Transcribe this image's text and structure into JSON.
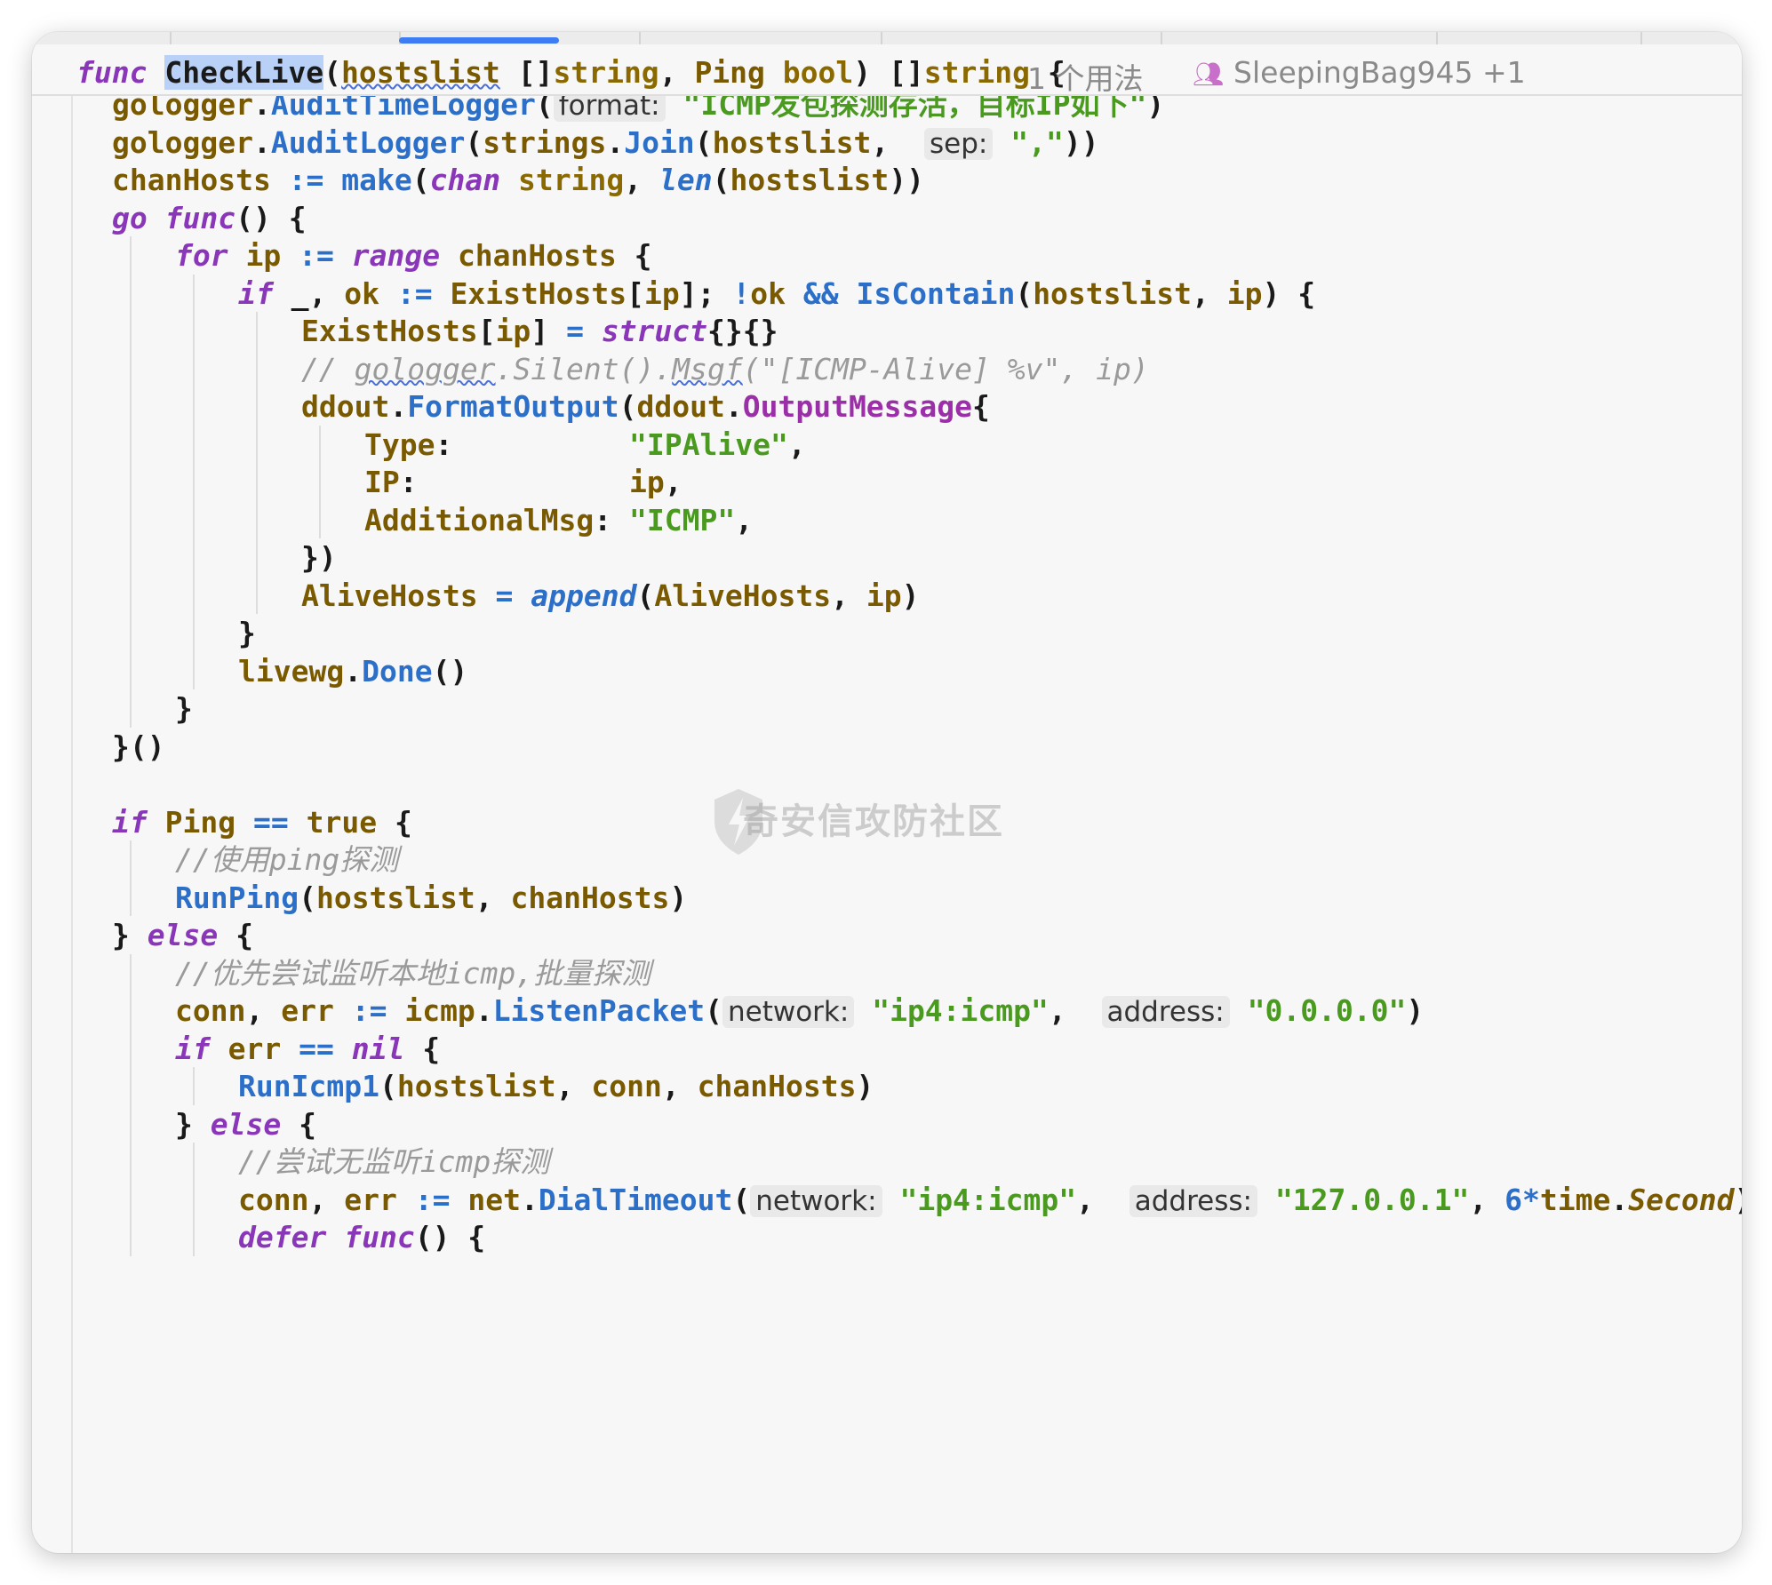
{
  "sticky": {
    "signature": [
      {
        "t": "func",
        "c": "kw"
      },
      {
        "t": " ",
        "c": "pl"
      },
      {
        "t": "CheckLive",
        "c": "sel"
      },
      {
        "t": "(",
        "c": "pl"
      },
      {
        "t": "hostslist",
        "c": "id squig"
      },
      {
        "t": " []",
        "c": "pl"
      },
      {
        "t": "string",
        "c": "ty"
      },
      {
        "t": ", ",
        "c": "pl"
      },
      {
        "t": "Ping",
        "c": "id"
      },
      {
        "t": " ",
        "c": "pl"
      },
      {
        "t": "bool",
        "c": "ty"
      },
      {
        "t": ") []",
        "c": "pl"
      },
      {
        "t": "string",
        "c": "ty"
      },
      {
        "t": " {",
        "c": "pl"
      }
    ],
    "usages": "1 个用法",
    "authors": "SleepingBag945 +1"
  },
  "watermark": "奇安信攻防社区",
  "lines": [
    {
      "indent": 1,
      "tokens": [
        {
          "t": "gologger",
          "c": "id"
        },
        {
          "t": ".",
          "c": "pl"
        },
        {
          "t": "AuditTimeLogger",
          "c": "fn"
        },
        {
          "t": "(",
          "c": "pl"
        },
        {
          "t": "format:",
          "c": "hintbox"
        },
        {
          "t": " ",
          "c": "pl"
        },
        {
          "t": "\"ICMP发包探测存活，目标IP如下\"",
          "c": "st"
        },
        {
          "t": ")",
          "c": "pl"
        }
      ]
    },
    {
      "indent": 1,
      "tokens": [
        {
          "t": "gologger",
          "c": "id"
        },
        {
          "t": ".",
          "c": "pl"
        },
        {
          "t": "AuditLogger",
          "c": "fn"
        },
        {
          "t": "(",
          "c": "pl"
        },
        {
          "t": "strings",
          "c": "id"
        },
        {
          "t": ".",
          "c": "pl"
        },
        {
          "t": "Join",
          "c": "fn"
        },
        {
          "t": "(",
          "c": "pl"
        },
        {
          "t": "hostslist",
          "c": "id"
        },
        {
          "t": ",  ",
          "c": "pl"
        },
        {
          "t": "sep:",
          "c": "hintbox"
        },
        {
          "t": " ",
          "c": "pl"
        },
        {
          "t": "\",\"",
          "c": "st"
        },
        {
          "t": "))",
          "c": "pl"
        }
      ]
    },
    {
      "indent": 1,
      "tokens": [
        {
          "t": "chanHosts",
          "c": "id"
        },
        {
          "t": " := ",
          "c": "op"
        },
        {
          "t": "make",
          "c": "fn"
        },
        {
          "t": "(",
          "c": "pl"
        },
        {
          "t": "chan",
          "c": "kw"
        },
        {
          "t": " ",
          "c": "pl"
        },
        {
          "t": "string",
          "c": "ty"
        },
        {
          "t": ", ",
          "c": "pl"
        },
        {
          "t": "len",
          "c": "fn kw"
        },
        {
          "t": "(",
          "c": "pl"
        },
        {
          "t": "hostslist",
          "c": "id"
        },
        {
          "t": "))",
          "c": "pl"
        }
      ]
    },
    {
      "indent": 1,
      "tokens": [
        {
          "t": "go",
          "c": "kw"
        },
        {
          "t": " ",
          "c": "pl"
        },
        {
          "t": "func",
          "c": "kw"
        },
        {
          "t": "() {",
          "c": "pl"
        }
      ]
    },
    {
      "indent": 2,
      "tokens": [
        {
          "t": "for",
          "c": "kw"
        },
        {
          "t": " ",
          "c": "pl"
        },
        {
          "t": "ip",
          "c": "id"
        },
        {
          "t": " := ",
          "c": "op"
        },
        {
          "t": "range",
          "c": "kw"
        },
        {
          "t": " ",
          "c": "pl"
        },
        {
          "t": "chanHosts",
          "c": "id"
        },
        {
          "t": " {",
          "c": "pl"
        }
      ]
    },
    {
      "indent": 3,
      "tokens": [
        {
          "t": "if",
          "c": "kw"
        },
        {
          "t": " _, ",
          "c": "pl"
        },
        {
          "t": "ok",
          "c": "id"
        },
        {
          "t": " := ",
          "c": "op"
        },
        {
          "t": "ExistHosts",
          "c": "id"
        },
        {
          "t": "[",
          "c": "pl"
        },
        {
          "t": "ip",
          "c": "id"
        },
        {
          "t": "]; ",
          "c": "pl"
        },
        {
          "t": "!",
          "c": "op"
        },
        {
          "t": "ok",
          "c": "id"
        },
        {
          "t": " && ",
          "c": "op"
        },
        {
          "t": "IsContain",
          "c": "fn"
        },
        {
          "t": "(",
          "c": "pl"
        },
        {
          "t": "hostslist",
          "c": "id"
        },
        {
          "t": ", ",
          "c": "pl"
        },
        {
          "t": "ip",
          "c": "id"
        },
        {
          "t": ") {",
          "c": "pl"
        }
      ]
    },
    {
      "indent": 4,
      "tokens": [
        {
          "t": "ExistHosts",
          "c": "id"
        },
        {
          "t": "[",
          "c": "pl"
        },
        {
          "t": "ip",
          "c": "id"
        },
        {
          "t": "] ",
          "c": "pl"
        },
        {
          "t": "=",
          "c": "op"
        },
        {
          "t": " ",
          "c": "pl"
        },
        {
          "t": "struct",
          "c": "kw"
        },
        {
          "t": "{}{}",
          "c": "pl"
        }
      ]
    },
    {
      "indent": 4,
      "tokens": [
        {
          "t": "// ",
          "c": "cm"
        },
        {
          "t": "gologger",
          "c": "cm squig"
        },
        {
          "t": ".Silent().",
          "c": "cm"
        },
        {
          "t": "Msgf",
          "c": "cm squig"
        },
        {
          "t": "(\"[ICMP-Alive] %v\", ip)",
          "c": "cm"
        }
      ]
    },
    {
      "indent": 4,
      "tokens": [
        {
          "t": "ddout",
          "c": "id"
        },
        {
          "t": ".",
          "c": "pl"
        },
        {
          "t": "FormatOutput",
          "c": "fn"
        },
        {
          "t": "(",
          "c": "pl"
        },
        {
          "t": "ddout",
          "c": "id"
        },
        {
          "t": ".",
          "c": "pl"
        },
        {
          "t": "OutputMessage",
          "c": "kw2"
        },
        {
          "t": "{",
          "c": "pl"
        }
      ]
    },
    {
      "indent": 5,
      "tokens": [
        {
          "t": "Type",
          "c": "id"
        },
        {
          "t": ":          ",
          "c": "pl"
        },
        {
          "t": "\"IPAlive\"",
          "c": "st"
        },
        {
          "t": ",",
          "c": "pl"
        }
      ]
    },
    {
      "indent": 5,
      "tokens": [
        {
          "t": "IP",
          "c": "id"
        },
        {
          "t": ":            ",
          "c": "pl"
        },
        {
          "t": "ip",
          "c": "id"
        },
        {
          "t": ",",
          "c": "pl"
        }
      ]
    },
    {
      "indent": 5,
      "tokens": [
        {
          "t": "AdditionalMsg",
          "c": "id"
        },
        {
          "t": ": ",
          "c": "pl"
        },
        {
          "t": "\"ICMP\"",
          "c": "st"
        },
        {
          "t": ",",
          "c": "pl"
        }
      ]
    },
    {
      "indent": 4,
      "tokens": [
        {
          "t": "})",
          "c": "pl"
        }
      ]
    },
    {
      "indent": 4,
      "tokens": [
        {
          "t": "AliveHosts",
          "c": "id"
        },
        {
          "t": " = ",
          "c": "op"
        },
        {
          "t": "append",
          "c": "fn kw"
        },
        {
          "t": "(",
          "c": "pl"
        },
        {
          "t": "AliveHosts",
          "c": "id"
        },
        {
          "t": ", ",
          "c": "pl"
        },
        {
          "t": "ip",
          "c": "id"
        },
        {
          "t": ")",
          "c": "pl"
        }
      ]
    },
    {
      "indent": 3,
      "tokens": [
        {
          "t": "}",
          "c": "pl"
        }
      ]
    },
    {
      "indent": 3,
      "tokens": [
        {
          "t": "livewg",
          "c": "id"
        },
        {
          "t": ".",
          "c": "pl"
        },
        {
          "t": "Done",
          "c": "fn"
        },
        {
          "t": "()",
          "c": "pl"
        }
      ]
    },
    {
      "indent": 2,
      "tokens": [
        {
          "t": "}",
          "c": "pl"
        }
      ]
    },
    {
      "indent": 1,
      "tokens": [
        {
          "t": "}()",
          "c": "pl"
        }
      ]
    },
    {
      "indent": 1,
      "tokens": []
    },
    {
      "indent": 1,
      "tokens": [
        {
          "t": "if",
          "c": "kw"
        },
        {
          "t": " ",
          "c": "pl"
        },
        {
          "t": "Ping",
          "c": "id"
        },
        {
          "t": " == ",
          "c": "op"
        },
        {
          "t": "true",
          "c": "id"
        },
        {
          "t": " {",
          "c": "pl"
        }
      ]
    },
    {
      "indent": 2,
      "tokens": [
        {
          "t": "//使用ping探测",
          "c": "cm"
        }
      ]
    },
    {
      "indent": 2,
      "tokens": [
        {
          "t": "RunPing",
          "c": "fn"
        },
        {
          "t": "(",
          "c": "pl"
        },
        {
          "t": "hostslist",
          "c": "id"
        },
        {
          "t": ", ",
          "c": "pl"
        },
        {
          "t": "chanHosts",
          "c": "id"
        },
        {
          "t": ")",
          "c": "pl"
        }
      ]
    },
    {
      "indent": 1,
      "tokens": [
        {
          "t": "} ",
          "c": "pl"
        },
        {
          "t": "else",
          "c": "kw"
        },
        {
          "t": " {",
          "c": "pl"
        }
      ]
    },
    {
      "indent": 2,
      "tokens": [
        {
          "t": "//优先尝试监听本地icmp,批量探测",
          "c": "cm"
        }
      ]
    },
    {
      "indent": 2,
      "tokens": [
        {
          "t": "conn",
          "c": "id"
        },
        {
          "t": ", ",
          "c": "pl"
        },
        {
          "t": "err",
          "c": "id"
        },
        {
          "t": " := ",
          "c": "op"
        },
        {
          "t": "icmp",
          "c": "id"
        },
        {
          "t": ".",
          "c": "pl"
        },
        {
          "t": "ListenPacket",
          "c": "fn"
        },
        {
          "t": "(",
          "c": "pl"
        },
        {
          "t": "network:",
          "c": "hintbox"
        },
        {
          "t": " ",
          "c": "pl"
        },
        {
          "t": "\"ip4:icmp\"",
          "c": "st"
        },
        {
          "t": ",  ",
          "c": "pl"
        },
        {
          "t": "address:",
          "c": "hintbox"
        },
        {
          "t": " ",
          "c": "pl"
        },
        {
          "t": "\"0.0.0.0\"",
          "c": "st"
        },
        {
          "t": ")",
          "c": "pl"
        }
      ]
    },
    {
      "indent": 2,
      "tokens": [
        {
          "t": "if",
          "c": "kw"
        },
        {
          "t": " ",
          "c": "pl"
        },
        {
          "t": "err",
          "c": "id"
        },
        {
          "t": " == ",
          "c": "op"
        },
        {
          "t": "nil",
          "c": "kw"
        },
        {
          "t": " {",
          "c": "pl"
        }
      ]
    },
    {
      "indent": 3,
      "tokens": [
        {
          "t": "RunIcmp1",
          "c": "fn"
        },
        {
          "t": "(",
          "c": "pl"
        },
        {
          "t": "hostslist",
          "c": "id"
        },
        {
          "t": ", ",
          "c": "pl"
        },
        {
          "t": "conn",
          "c": "id"
        },
        {
          "t": ", ",
          "c": "pl"
        },
        {
          "t": "chanHosts",
          "c": "id"
        },
        {
          "t": ")",
          "c": "pl"
        }
      ]
    },
    {
      "indent": 2,
      "tokens": [
        {
          "t": "} ",
          "c": "pl"
        },
        {
          "t": "else",
          "c": "kw"
        },
        {
          "t": " {",
          "c": "pl"
        }
      ]
    },
    {
      "indent": 3,
      "tokens": [
        {
          "t": "//尝试无监听icmp探测",
          "c": "cm"
        }
      ]
    },
    {
      "indent": 3,
      "tokens": [
        {
          "t": "conn",
          "c": "id"
        },
        {
          "t": ", ",
          "c": "pl"
        },
        {
          "t": "err",
          "c": "id"
        },
        {
          "t": " := ",
          "c": "op"
        },
        {
          "t": "net",
          "c": "id"
        },
        {
          "t": ".",
          "c": "pl"
        },
        {
          "t": "DialTimeout",
          "c": "fn"
        },
        {
          "t": "(",
          "c": "pl"
        },
        {
          "t": "network:",
          "c": "hintbox"
        },
        {
          "t": " ",
          "c": "pl"
        },
        {
          "t": "\"ip4:icmp\"",
          "c": "st"
        },
        {
          "t": ",  ",
          "c": "pl"
        },
        {
          "t": "address:",
          "c": "hintbox"
        },
        {
          "t": " ",
          "c": "pl"
        },
        {
          "t": "\"127.0.0.1\"",
          "c": "st"
        },
        {
          "t": ", ",
          "c": "pl"
        },
        {
          "t": "6",
          "c": "nm"
        },
        {
          "t": "*",
          "c": "op"
        },
        {
          "t": "time",
          "c": "id"
        },
        {
          "t": ".",
          "c": "pl"
        },
        {
          "t": "Second",
          "c": "id kwi"
        },
        {
          "t": ")",
          "c": "pl"
        }
      ]
    },
    {
      "indent": 3,
      "tokens": [
        {
          "t": "defer",
          "c": "kw"
        },
        {
          "t": " ",
          "c": "pl"
        },
        {
          "t": "func",
          "c": "kw"
        },
        {
          "t": "() {",
          "c": "pl"
        }
      ]
    }
  ],
  "colors": {
    "keyword": "#8a36b8",
    "identifier": "#7a5a00",
    "function": "#2b6fc9",
    "string": "#4a9a20",
    "comment": "#9a9a9a",
    "selection": "#b9d1f6"
  }
}
